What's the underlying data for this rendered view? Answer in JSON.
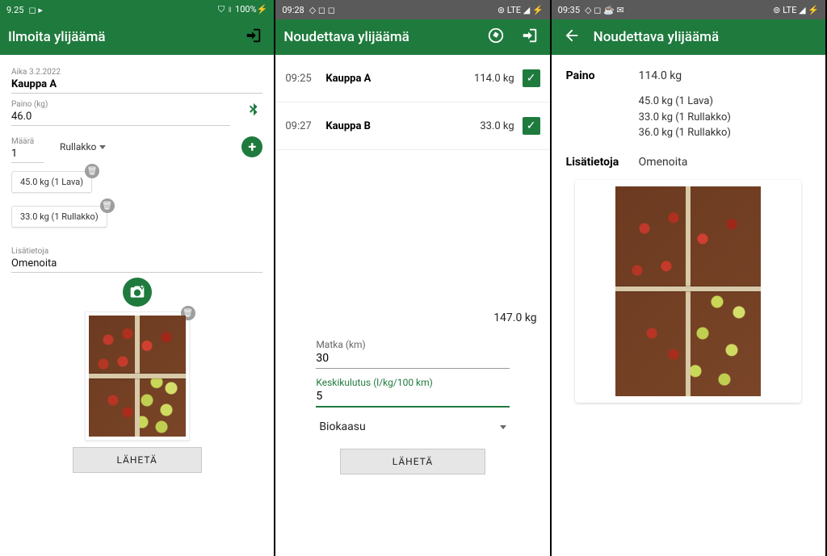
{
  "screen1": {
    "status": {
      "time": "9.25",
      "icons_right": "⛉ ॥ 100%⚡"
    },
    "title": "Ilmoita ylijäämä",
    "time_label": "Aika 3.2.2022",
    "store": "Kauppa A",
    "weight_label": "Paino (kg)",
    "weight": "46.0",
    "qty_label": "Määrä",
    "qty": "1",
    "unit": "Rullakko",
    "chips": [
      "45.0 kg (1 Lava)",
      "33.0 kg (1 Rullakko)"
    ],
    "extra_label": "Lisätietoja",
    "extra": "Omenoita",
    "send": "LÄHETÄ"
  },
  "screen2": {
    "status": {
      "time": "09:28",
      "lte": "LTE"
    },
    "title": "Noudettava ylijäämä",
    "rows": [
      {
        "time": "09:25",
        "store": "Kauppa A",
        "weight": "114.0 kg"
      },
      {
        "time": "09:27",
        "store": "Kauppa B",
        "weight": "33.0 kg"
      }
    ],
    "total": "147.0 kg",
    "distance_label": "Matka (km)",
    "distance": "30",
    "consumption_label": "Keskikulutus (l/kg/100 km)",
    "consumption": "5",
    "fuel": "Biokaasu",
    "send": "LÄHETÄ"
  },
  "screen3": {
    "status": {
      "time": "09:35",
      "lte": "LTE"
    },
    "title": "Noudettava ylijäämä",
    "weight_label": "Paino",
    "weight": "114.0 kg",
    "lines": [
      "45.0 kg (1 Lava)",
      "33.0 kg (1 Rullakko)",
      "36.0 kg (1 Rullakko)"
    ],
    "extra_label": "Lisätietoja",
    "extra": "Omenoita"
  }
}
